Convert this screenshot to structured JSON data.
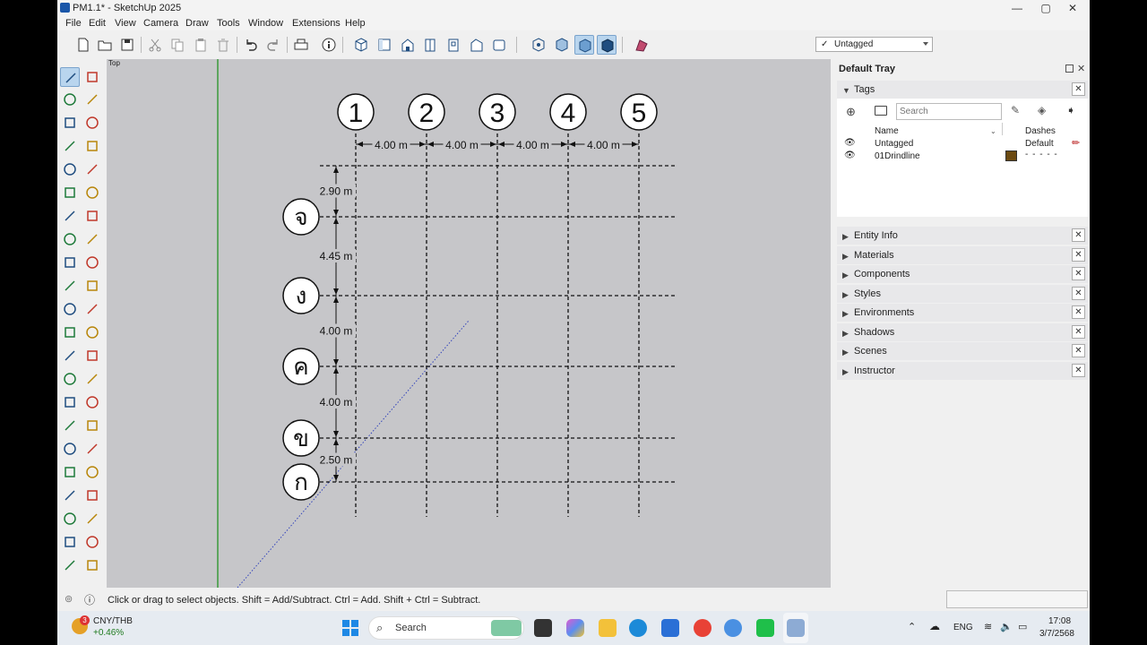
{
  "window": {
    "title": "PM1.1* - SketchUp 2025",
    "minimize": "—",
    "maximize": "▢",
    "close": "✕"
  },
  "menu": [
    "File",
    "Edit",
    "View",
    "Camera",
    "Draw",
    "Tools",
    "Window",
    "Extensions",
    "Help"
  ],
  "tag_selector": {
    "value": "Untagged",
    "check": "✓"
  },
  "viewport": {
    "view_label": "Top",
    "columns": [
      "1",
      "2",
      "3",
      "4",
      "5"
    ],
    "column_spacing": [
      "4.00 m",
      "4.00 m",
      "4.00 m",
      "4.00 m"
    ],
    "rows": [
      "จ",
      "ง",
      "ค",
      "ข",
      "ก"
    ],
    "row_spacing": [
      "2.90 m",
      "4.45 m",
      "4.00 m",
      "4.00 m",
      "2.50 m"
    ]
  },
  "tray": {
    "title": "Default Tray",
    "tags": {
      "label": "Tags",
      "search_placeholder": "Search",
      "col_name": "Name",
      "col_dashes": "Dashes",
      "rows": [
        {
          "name": "Untagged",
          "dashes": "Default",
          "color": "#ffffff"
        },
        {
          "name": "01Drindline",
          "dashes": "- - - - -",
          "color": "#6b4a12"
        }
      ]
    },
    "panels": [
      "Entity Info",
      "Materials",
      "Components",
      "Styles",
      "Environments",
      "Shadows",
      "Scenes",
      "Instructor"
    ]
  },
  "status": {
    "text": "Click or drag to select objects. Shift = Add/Subtract. Ctrl = Add. Shift + Ctrl = Subtract."
  },
  "taskbar": {
    "weather_badge": "3",
    "ticker": "CNY/THB",
    "ticker_change": "+0.46%",
    "search": "Search",
    "lang": "ENG",
    "time": "17:08",
    "date": "3/7/2568"
  },
  "colors": {
    "accent": "#b9d5ee",
    "grid_green": "#3a9a3a",
    "tag_brown": "#6b4a12"
  }
}
